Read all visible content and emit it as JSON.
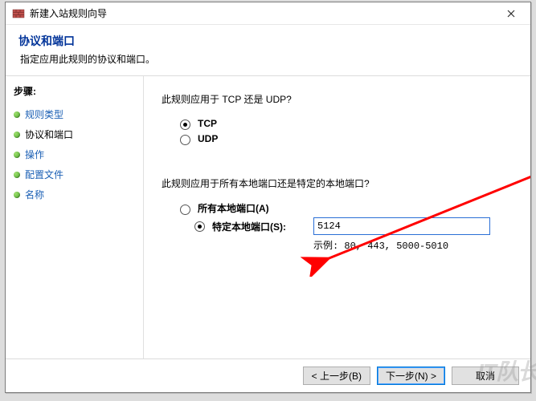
{
  "window": {
    "title": "新建入站规则向导",
    "close_aria": "Close"
  },
  "header": {
    "title": "协议和端口",
    "subtitle": "指定应用此规则的协议和端口。"
  },
  "sidebar": {
    "steps_header": "步骤:",
    "items": [
      {
        "label": "规则类型",
        "current": false
      },
      {
        "label": "协议和端口",
        "current": true
      },
      {
        "label": "操作",
        "current": false
      },
      {
        "label": "配置文件",
        "current": false
      },
      {
        "label": "名称",
        "current": false
      }
    ]
  },
  "content": {
    "q1": "此规则应用于 TCP 还是 UDP?",
    "proto": {
      "tcp_label": "TCP",
      "udp_label": "UDP",
      "selected": "tcp"
    },
    "q2": "此规则应用于所有本地端口还是特定的本地端口?",
    "ports": {
      "all_label": "所有本地端口(A)",
      "specific_label": "特定本地端口(S):",
      "selected": "specific",
      "value": "5124",
      "example": "示例: 80, 443, 5000-5010"
    }
  },
  "footer": {
    "back": "< 上一步(B)",
    "next": "下一步(N) >",
    "cancel": "取消"
  },
  "watermark": "IT队长"
}
